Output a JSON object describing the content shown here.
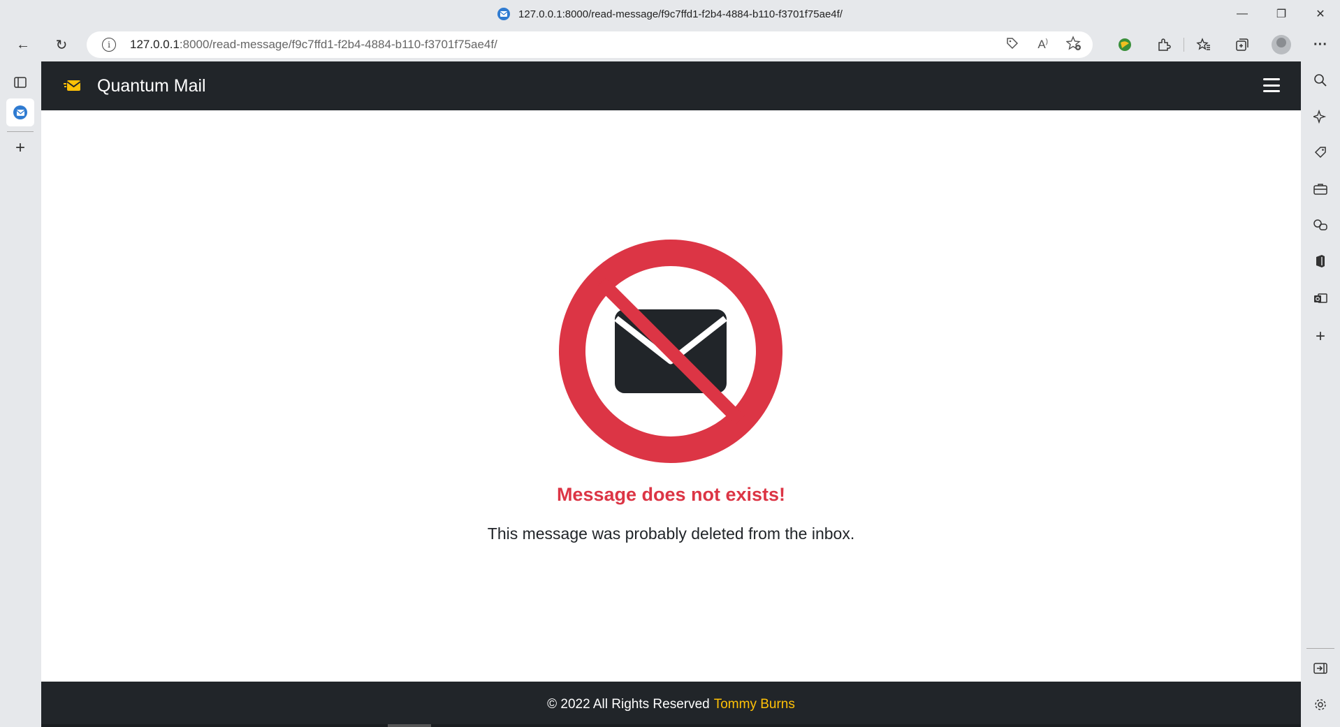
{
  "browser": {
    "window_title": "127.0.0.1:8000/read-message/f9c7ffd1-f2b4-4884-b110-f3701f75ae4f/",
    "url_host": "127.0.0.1",
    "url_path": ":8000/read-message/f9c7ffd1-f2b4-4884-b110-f3701f75ae4f/",
    "window_controls": {
      "minimize": "—",
      "restore": "❐",
      "close": "✕"
    },
    "nav": {
      "back": "←",
      "refresh": "↻"
    },
    "address_icons": [
      "tag-icon",
      "read-aloud-icon",
      "favorite-add-icon"
    ],
    "toolbar_icons": [
      "profile-ext-icon",
      "extensions-icon",
      "favorites-icon",
      "collections-icon",
      "profile-avatar",
      "more-icon"
    ],
    "more_glyph": "···"
  },
  "app": {
    "brand_name": "Quantum Mail",
    "accent_color": "#ffc107",
    "navbar_color": "#212529"
  },
  "error": {
    "title": "Message does not exists!",
    "description": "This message was probably deleted from the inbox.",
    "color": "#dc3545"
  },
  "footer": {
    "text": "© 2022 All Rights Reserved",
    "author": "Tommy Burns"
  }
}
